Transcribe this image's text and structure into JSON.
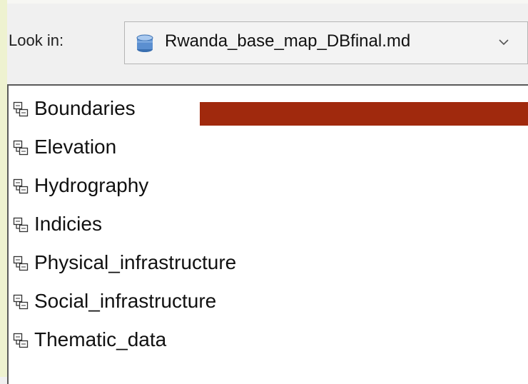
{
  "look_in": {
    "label": "Look in:",
    "value": "Rwanda_base_map_DBfinal.md",
    "icon": "database-icon",
    "dropdown_icon": "chevron-down-icon"
  },
  "list": {
    "item_icon": "feature-dataset-icon",
    "items": [
      {
        "label": "Boundaries"
      },
      {
        "label": "Elevation"
      },
      {
        "label": "Hydrography"
      },
      {
        "label": "Indicies"
      },
      {
        "label": "Physical_infrastructure"
      },
      {
        "label": "Social_infrastructure"
      },
      {
        "label": "Thematic_data"
      }
    ]
  },
  "colors": {
    "redaction_bar": "#a0290d",
    "left_accent": "#eef2d0",
    "window_bg": "#f0f0f0",
    "list_bg": "#ffffff"
  }
}
